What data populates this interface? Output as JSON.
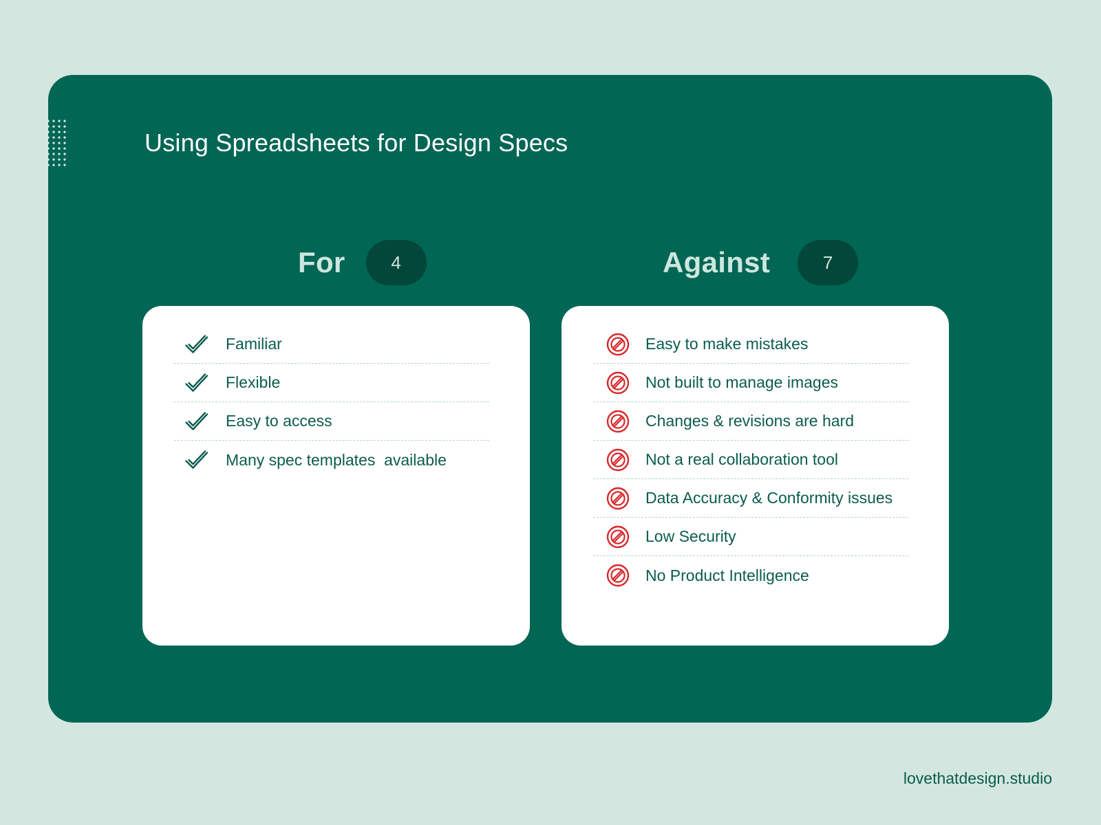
{
  "title": "Using Spreadsheets for Design Specs",
  "for": {
    "label": "For",
    "count": "4",
    "icon": "check-icon",
    "items": [
      "Familiar",
      "Flexible",
      "Easy to access",
      "Many spec templates  available"
    ]
  },
  "against": {
    "label": "Against",
    "count": "7",
    "icon": "prohibited-icon",
    "items": [
      "Easy to make mistakes",
      "Not built to manage images",
      "Changes & revisions are hard",
      "Not a real collaboration tool",
      "Data Accuracy & Conformity issues",
      "Low Security",
      "No Product Intelligence"
    ]
  },
  "footer": "lovethatdesign.studio",
  "colors": {
    "background": "#d3e7e0",
    "card": "#016654",
    "badge": "#02473a",
    "check": "#0b5c4c",
    "prohibited": "#d8282b"
  }
}
